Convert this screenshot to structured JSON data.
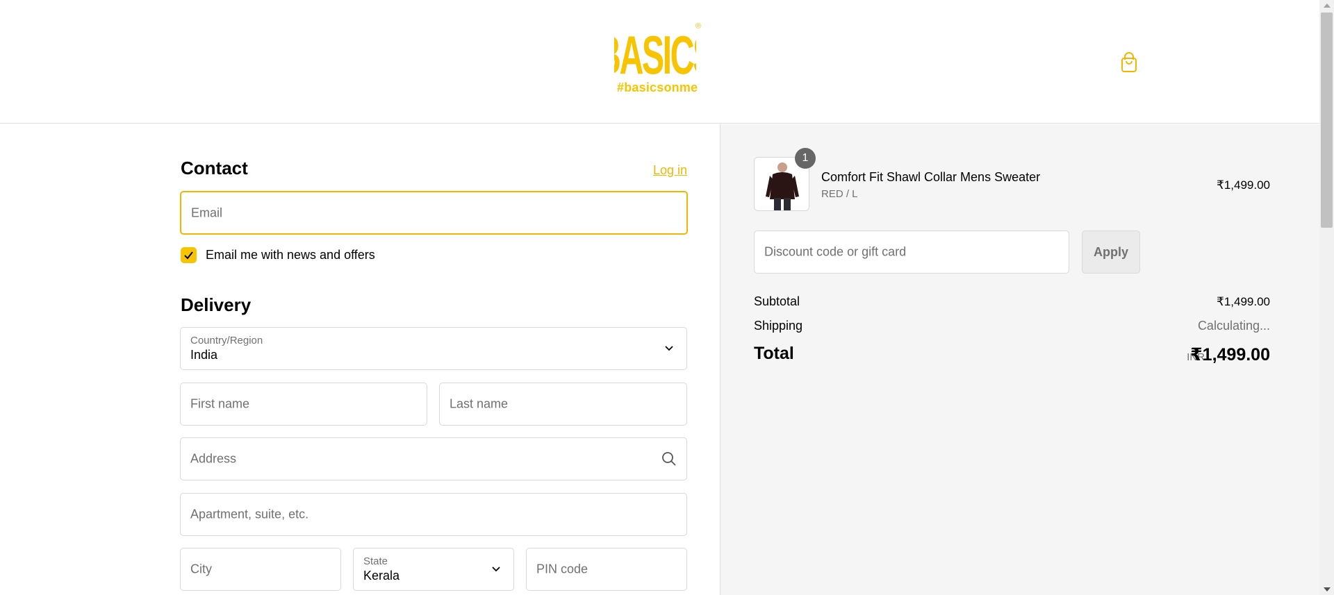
{
  "brand": {
    "logo_text": "BASICS",
    "registered_mark": "®",
    "tagline": "#basicsonme",
    "accent_color": "#f6c400"
  },
  "header": {
    "cart_icon": "shopping-bag-icon"
  },
  "contact": {
    "title": "Contact",
    "login_link": "Log in",
    "email_placeholder": "Email",
    "newsletter_checked": true,
    "newsletter_label": "Email me with news and offers"
  },
  "delivery": {
    "title": "Delivery",
    "country_label": "Country/Region",
    "country_value": "India",
    "first_name_placeholder": "First name",
    "last_name_placeholder": "Last name",
    "address_placeholder": "Address",
    "apartment_placeholder": "Apartment, suite, etc.",
    "city_placeholder": "City",
    "state_label": "State",
    "state_value": "Kerala",
    "pin_placeholder": "PIN code"
  },
  "summary": {
    "product": {
      "quantity": "1",
      "name": "Comfort Fit Shawl Collar Mens Sweater",
      "variant": "RED / L",
      "price": "₹1,499.00"
    },
    "discount_placeholder": "Discount code or gift card",
    "apply_label": "Apply",
    "subtotal_label": "Subtotal",
    "subtotal_value": "₹1,499.00",
    "shipping_label": "Shipping",
    "shipping_value": "Calculating...",
    "total_label": "Total",
    "currency": "INR",
    "total_value": "₹1,499.00"
  }
}
